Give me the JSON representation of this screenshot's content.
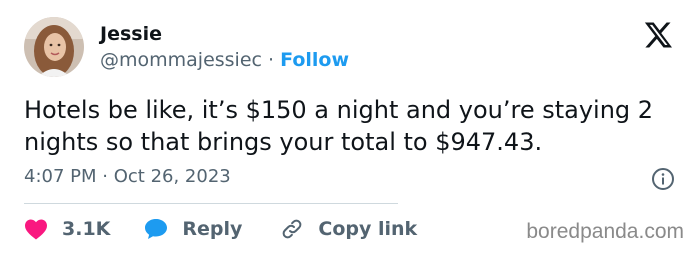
{
  "author": {
    "name": "Jessie",
    "handle": "@mommajessiec",
    "separator": "·",
    "follow_label": "Follow"
  },
  "tweet": {
    "text": "Hotels be like, it’s $150 a night and you’re staying 2 nights so that brings your total to $947.43.",
    "time": "4:07 PM",
    "date_separator": "·",
    "date": "Oct 26, 2023"
  },
  "actions": {
    "likes_count": "3.1K",
    "reply_label": "Reply",
    "copy_link_label": "Copy link"
  },
  "watermark": "boredpanda.com",
  "colors": {
    "accent": "#1d9bf0",
    "like": "#f91880",
    "text": "#0f1419",
    "secondary": "#536471"
  },
  "icons": {
    "platform": "x-logo-icon",
    "info": "info-icon",
    "like": "heart-icon",
    "reply": "speech-bubble-icon",
    "copy": "link-icon"
  }
}
